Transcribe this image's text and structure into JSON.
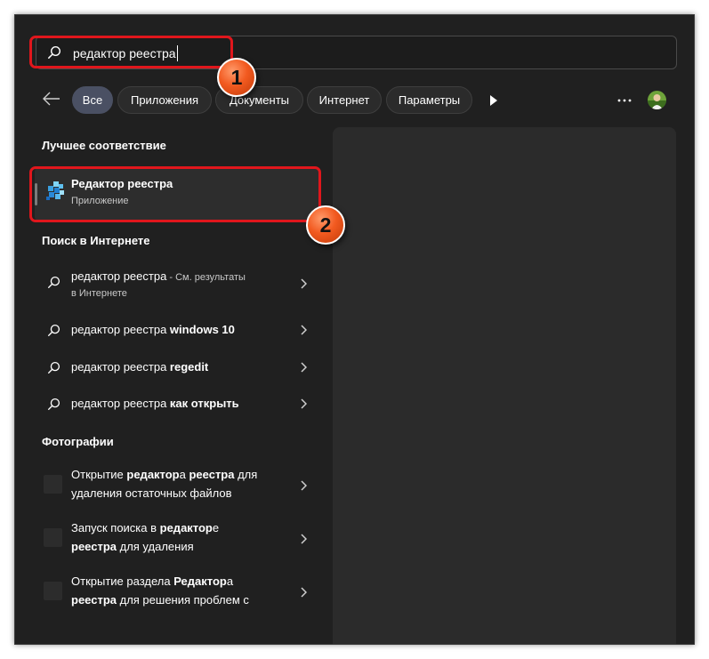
{
  "search": {
    "value": "редактор реестра"
  },
  "filters": {
    "back_icon": "arrow-left-icon",
    "chips": [
      "Все",
      "Приложения",
      "Документы",
      "Интернет",
      "Параметры"
    ],
    "more_icon": "play-icon",
    "menu_icon": "ellipsis-icon"
  },
  "best_match": {
    "heading": "Лучшее соответствие",
    "name": "Редактор реестра",
    "type": "Приложение",
    "icon": "regedit-icon"
  },
  "web": {
    "heading": "Поиск в Интернете",
    "items": [
      {
        "query": "редактор реестра",
        "suffix": " - См. результаты",
        "line2": "в Интернете"
      },
      {
        "query": "редактор реестра ",
        "bold": "windows 10"
      },
      {
        "query": "редактор реестра ",
        "bold": "regedit"
      },
      {
        "query": "редактор реестра ",
        "bold": "как открыть"
      }
    ]
  },
  "photos": {
    "heading": "Фотографии",
    "items": [
      {
        "l1a": "Открытие ",
        "l1b": "редактор",
        "l1c": "а ",
        "l1d": "реестра",
        "l1e": " для",
        "l2a": "удаления остаточных файлов",
        "l2b": "",
        "l2c": ""
      },
      {
        "l1a": "Запуск поиска в ",
        "l1b": "редактор",
        "l1c": "е",
        "l1d": "",
        "l1e": "",
        "l2a": "",
        "l2b": "реестра",
        "l2c": " для удаления"
      },
      {
        "l1a": "Открытие раздела ",
        "l1b": "Редактор",
        "l1c": "а",
        "l1d": "",
        "l1e": "",
        "l2a": "",
        "l2b": "реестра",
        "l2c": " для решения проблем с"
      }
    ]
  },
  "annotations": [
    "1",
    "2"
  ],
  "colors": {
    "highlight": "#e0161c",
    "badge": "#f25a20",
    "active_chip": "#4a5063",
    "background": "#202020"
  }
}
